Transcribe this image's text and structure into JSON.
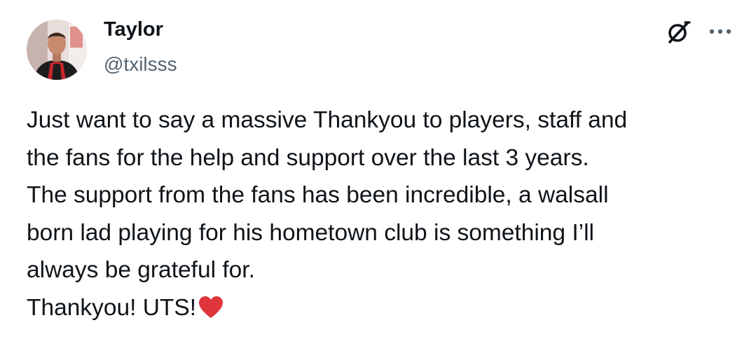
{
  "post": {
    "author": {
      "display_name": "Taylor",
      "handle": "@txilsss",
      "avatar": "profile-photo"
    },
    "actions": {
      "grok_icon": "grok-icon",
      "more_icon": "more-horizontal-icon"
    },
    "text_lines": [
      "Just want to say a massive Thankyou to players, staff and",
      "the fans for the help and support over the last 3 years.",
      "The support from the fans has been incredible, a walsall",
      "born lad playing for his hometown club is something I’ll",
      "always be grateful for.",
      "Thankyou! UTS!"
    ],
    "trailing_emoji": "red-heart-emoji",
    "colors": {
      "text": "#0f1419",
      "secondary_text": "#536471",
      "heart": "#e0353a"
    }
  }
}
